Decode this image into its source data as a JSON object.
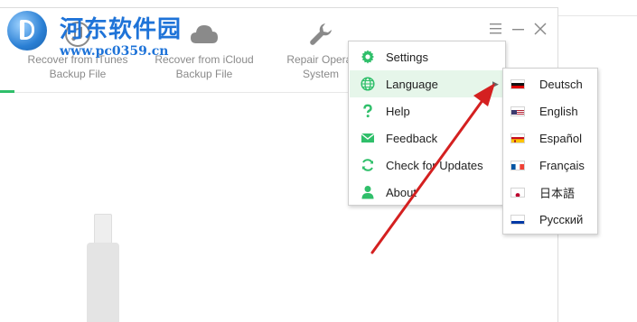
{
  "toolbar": {
    "tools": [
      {
        "label": "Recover from iTunes Backup File",
        "line1": "Recover from iTunes",
        "line2": "Backup File",
        "icon": "music-note-icon"
      },
      {
        "label": "Recover from iCloud Backup File",
        "line1": "Recover from iCloud",
        "line2": "Backup File",
        "icon": "cloud-icon"
      },
      {
        "label": "Repair Operating System",
        "line1": "Repair Operat",
        "line2": "System",
        "icon": "wrench-icon"
      }
    ]
  },
  "watermark": {
    "title": "河东软件园",
    "url": "www.pc0359.cn"
  },
  "main_menu": {
    "items": [
      {
        "label": "Settings",
        "icon": "gear-icon"
      },
      {
        "label": "Language",
        "icon": "globe-icon",
        "active": true,
        "submenu_indicator": "▶"
      },
      {
        "label": "Help",
        "icon": "question-icon"
      },
      {
        "label": "Feedback",
        "icon": "envelope-icon"
      },
      {
        "label": "Check for Updates",
        "icon": "refresh-icon"
      },
      {
        "label": "About",
        "icon": "person-icon"
      }
    ]
  },
  "language_menu": {
    "items": [
      {
        "label": "Deutsch",
        "flag": "de-flag-icon"
      },
      {
        "label": "English",
        "flag": "us-flag-icon"
      },
      {
        "label": "Español",
        "flag": "es-flag-icon"
      },
      {
        "label": "Français",
        "flag": "fr-flag-icon"
      },
      {
        "label": "日本語",
        "flag": "jp-flag-icon"
      },
      {
        "label": "Русский",
        "flag": "ru-flag-icon"
      }
    ]
  },
  "colors": {
    "accent": "#2fbf6a",
    "menu_icon": "#2fbf6a",
    "active_row": "#e6f6ea",
    "annotation_arrow": "#d42020",
    "watermark": "#1e73d8"
  }
}
